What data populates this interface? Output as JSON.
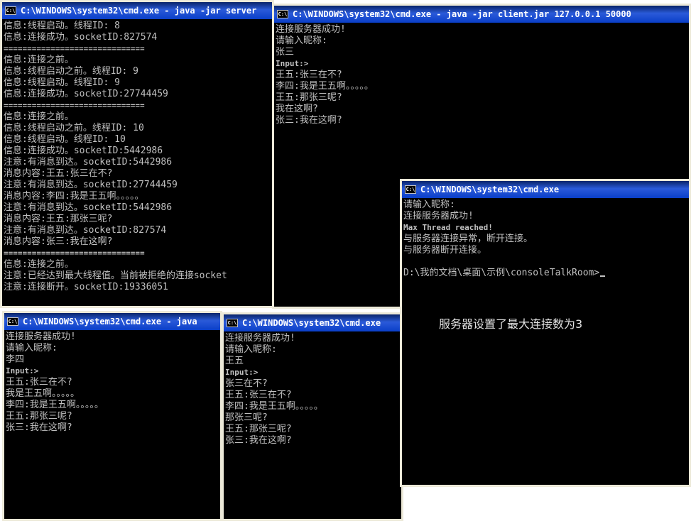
{
  "server_window": {
    "title": "C:\\WINDOWS\\system32\\cmd.exe - java -jar server",
    "lines": [
      "信息:线程启动。线程ID: 8",
      "信息:连接成功。socketID:827574",
      "==============================",
      "信息:连接之前。",
      "信息:线程启动之前。线程ID: 9",
      "信息:线程启动。线程ID: 9",
      "信息:连接成功。socketID:27744459",
      "==============================",
      "信息:连接之前。",
      "信息:线程启动之前。线程ID: 10",
      "信息:线程启动。线程ID: 10",
      "信息:连接成功。socketID:5442986",
      "注意:有消息到达。socketID:5442986",
      "消息内容:王五:张三在不?",
      "注意:有消息到达。socketID:27744459",
      "消息内容:李四:我是王五啊。。。。。",
      "注意:有消息到达。socketID:5442986",
      "消息内容:王五:那张三呢?",
      "注意:有消息到达。socketID:827574",
      "消息内容:张三:我在这啊?",
      "==============================",
      "信息:连接之前。",
      "注意:已经达到最大线程值。当前被拒绝的连接socket",
      "注意:连接断开。socketID:19336051"
    ]
  },
  "client_zhangsan_window": {
    "title": "C:\\WINDOWS\\system32\\cmd.exe - java -jar client.jar 127.0.0.1 50000",
    "lines": [
      "连接服务器成功!",
      "请输入昵称:",
      "张三",
      "Input:>",
      "王五:张三在不?",
      "李四:我是王五啊。。。。。",
      "王五:那张三呢?",
      "我在这啊?",
      "张三:我在这啊?"
    ]
  },
  "rejected_client_window": {
    "title": "C:\\WINDOWS\\system32\\cmd.exe",
    "lines": [
      "请输入昵称:",
      "连接服务器成功!",
      "Max Thread reached!",
      "与服务器连接异常，断开连接。",
      "与服务器断开连接。",
      "",
      "D:\\我的文档\\桌面\\示例\\consoleTalkRoom>"
    ],
    "annotation": "服务器设置了最大连接数为3"
  },
  "client_lisi_window": {
    "title": "C:\\WINDOWS\\system32\\cmd.exe - java",
    "lines": [
      "连接服务器成功!",
      "请输入昵称:",
      "李四",
      "Input:>",
      "王五:张三在不?",
      "我是王五啊。。。。。",
      "李四:我是王五啊。。。。。",
      "王五:那张三呢?",
      "张三:我在这啊?"
    ]
  },
  "client_wangwu_window": {
    "title": "C:\\WINDOWS\\system32\\cmd.exe",
    "lines": [
      "连接服务器成功!",
      "请输入昵称:",
      "王五",
      "Input:>",
      "张三在不?",
      "王五:张三在不?",
      "李四:我是王五啊。。。。。",
      "那张三呢?",
      "王五:那张三呢?",
      "张三:我在这啊?"
    ]
  },
  "icons": {
    "cmd": "cmd-window-icon"
  }
}
